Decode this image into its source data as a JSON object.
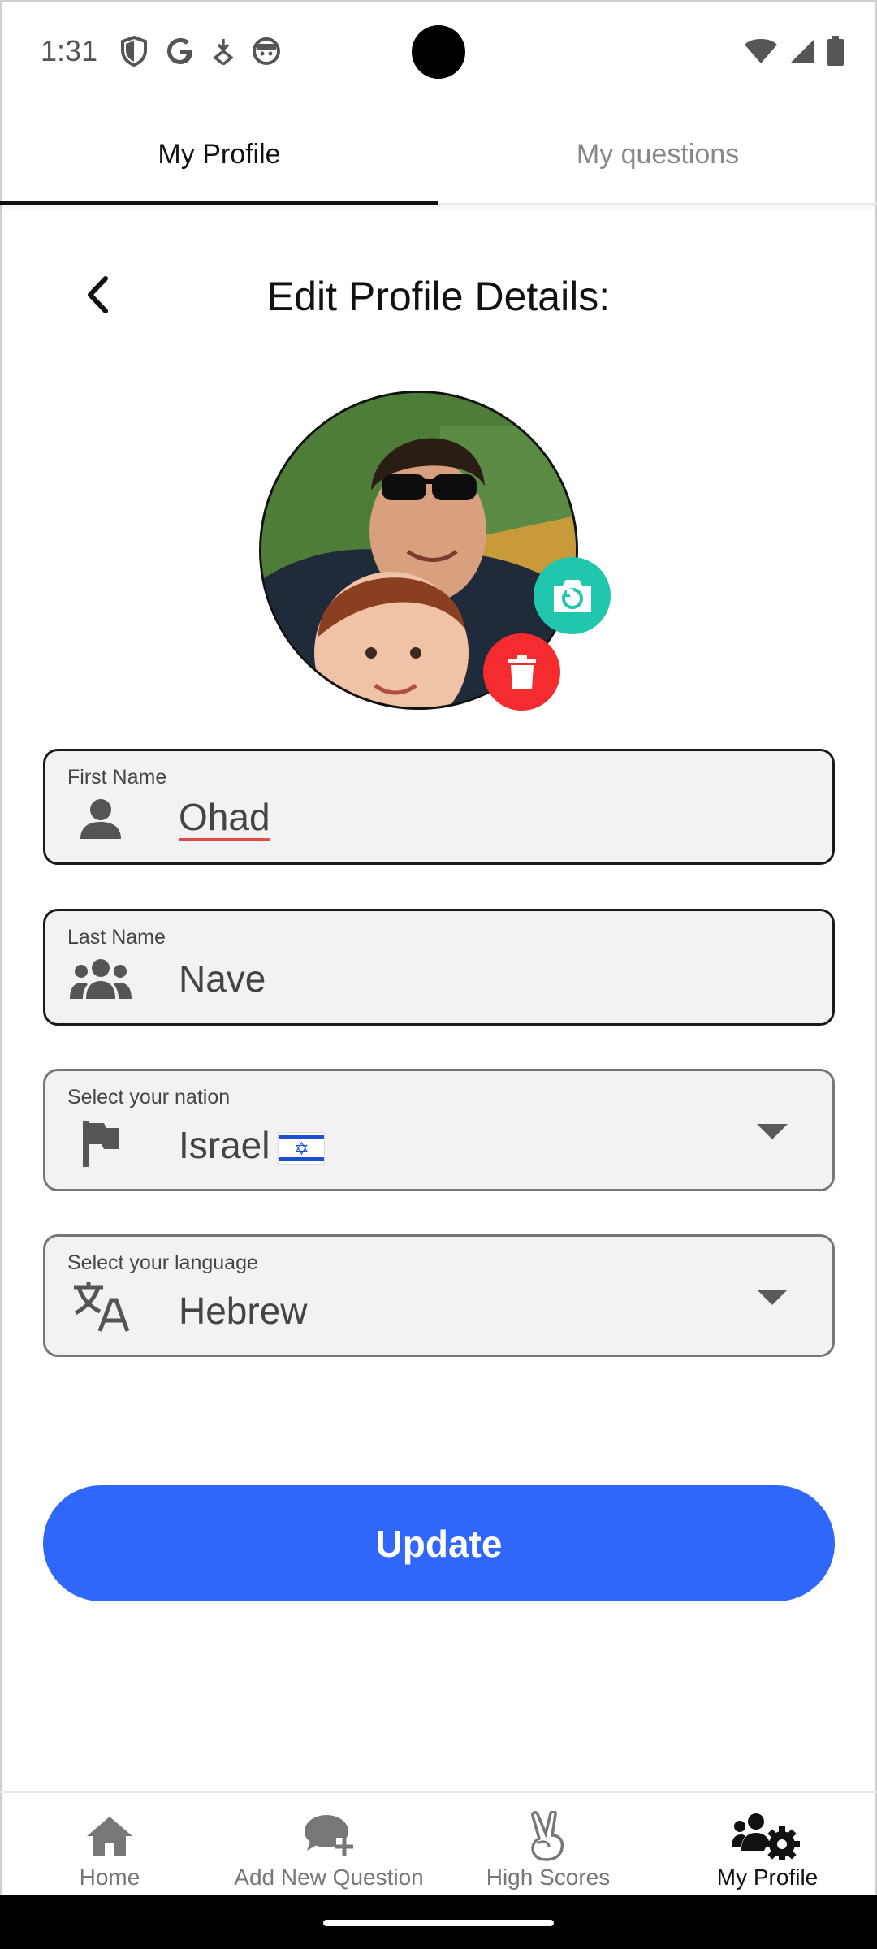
{
  "status_bar": {
    "time": "1:31",
    "left_icons": [
      "shield-icon",
      "google-icon",
      "download-arrow-icon",
      "face-icon"
    ],
    "right_icons": [
      "wifi-icon",
      "signal-icon",
      "battery-icon"
    ]
  },
  "top_tabs": [
    {
      "label": "My Profile",
      "active": true
    },
    {
      "label": "My questions",
      "active": false
    }
  ],
  "header": {
    "title": "Edit Profile Details:"
  },
  "avatar": {
    "camera_icon": "camera-rotate-icon",
    "delete_icon": "trash-icon",
    "camera_color": "#21c7ac",
    "delete_color": "#f42b2f"
  },
  "form": {
    "first_name": {
      "label": "First Name",
      "value": "Ohad",
      "icon": "person-icon"
    },
    "last_name": {
      "label": "Last Name",
      "value": "Nave",
      "icon": "group-icon"
    },
    "nation": {
      "label": "Select your nation",
      "value": "Israel",
      "icon": "flag-icon",
      "flag": "israel-flag"
    },
    "language": {
      "label": "Select your language",
      "value": "Hebrew",
      "icon": "translate-icon"
    }
  },
  "update_button": {
    "label": "Update",
    "color": "#2f67fa"
  },
  "bottom_nav": [
    {
      "label": "Home",
      "icon": "home-icon",
      "active": false
    },
    {
      "label": "Add New Question",
      "icon": "add-comment-icon",
      "active": false
    },
    {
      "label": "High Scores",
      "icon": "victory-hand-icon",
      "active": false
    },
    {
      "label": "My Profile",
      "icon": "users-gear-icon",
      "active": true
    }
  ]
}
